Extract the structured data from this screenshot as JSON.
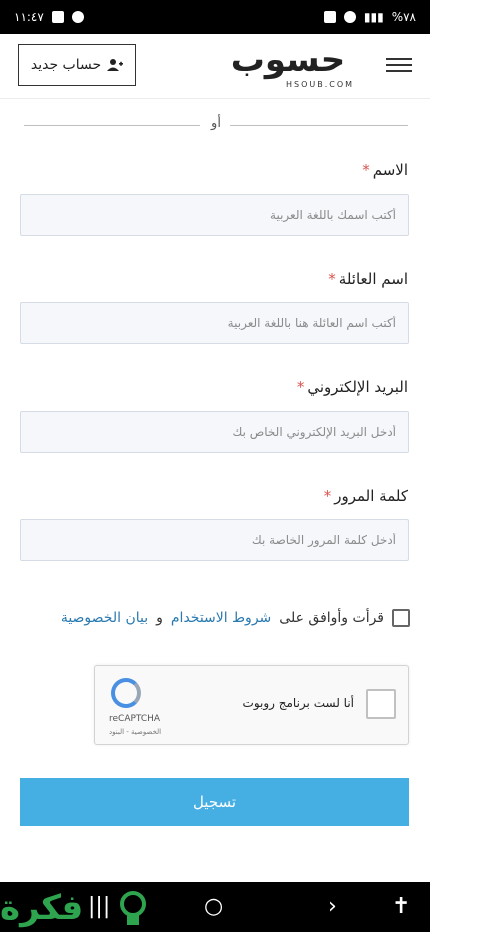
{
  "status_bar": {
    "time": "١١:٤٧",
    "battery": "%٧٨"
  },
  "header": {
    "new_account_label": "حساب جديد",
    "logo_text": "حسوب",
    "logo_sub": "HSOUB.COM"
  },
  "divider": {
    "or_text": "أو"
  },
  "form": {
    "first_name": {
      "label": "الاسم",
      "placeholder": "أكتب اسمك باللغة العربية"
    },
    "last_name": {
      "label": "اسم العائلة",
      "placeholder": "أكتب اسم العائلة هنا باللغة العربية"
    },
    "email": {
      "label": "البريد الإلكتروني",
      "placeholder": "أدخل البريد الإلكتروني الخاص بك"
    },
    "password": {
      "label": "كلمة المرور",
      "placeholder": "أدخل كلمة المرور الخاصة بك"
    },
    "required_mark": "*"
  },
  "terms": {
    "prefix": "قرأت وأوافق على",
    "terms_link": "شروط الاستخدام",
    "and": "و",
    "privacy_link": "بيان الخصوصية"
  },
  "recaptcha": {
    "label": "أنا لست برنامج روبوت",
    "brand": "reCAPTCHA",
    "links": "الخصوصية - البنود"
  },
  "submit": {
    "label": "تسجيل"
  },
  "watermark": {
    "text": "فكرة"
  }
}
